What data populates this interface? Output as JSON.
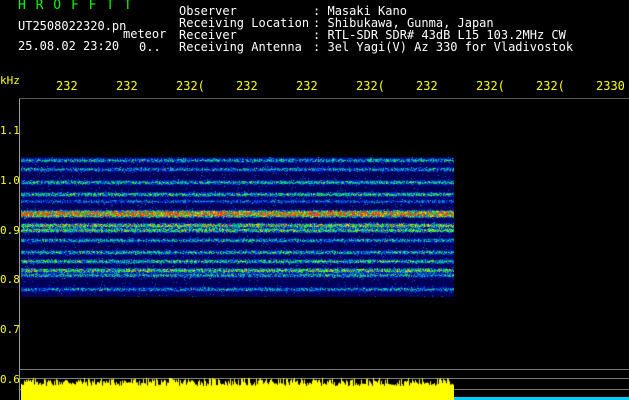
{
  "header": {
    "title": "H R O F F T T",
    "filename": "UT2508022320.pn",
    "mode": "meteor",
    "datetime": "25.08.02 23:20",
    "counter": "0..",
    "labels": [
      "Observer",
      "Receiving Location",
      "Receiver",
      "Receiving Antenna"
    ],
    "separators": [
      ":",
      ":",
      ":",
      ":"
    ],
    "values": [
      "Masaki Kano",
      "Shibukawa, Gunma, Japan",
      "RTL-SDR SDR# 43dB L15 103.2MHz CW",
      "3el Yagi(V) Az 330 for Vladivostok"
    ]
  },
  "axis": {
    "unit": "kHz",
    "x_ticks": [
      "232",
      "232",
      "232(",
      "232",
      "232",
      "232(",
      "232",
      "232(",
      "232(",
      "2330"
    ],
    "y_ticks": [
      "1.1",
      "1.0",
      "0.9",
      "0.8",
      "0.7",
      "0.6"
    ]
  },
  "colors": {
    "text_green": "#00ff00",
    "text_white": "#ffffff",
    "text_yellow": "#ffff00",
    "spectrum_bg": "#000030",
    "signal_bar": "#ffff00"
  }
}
